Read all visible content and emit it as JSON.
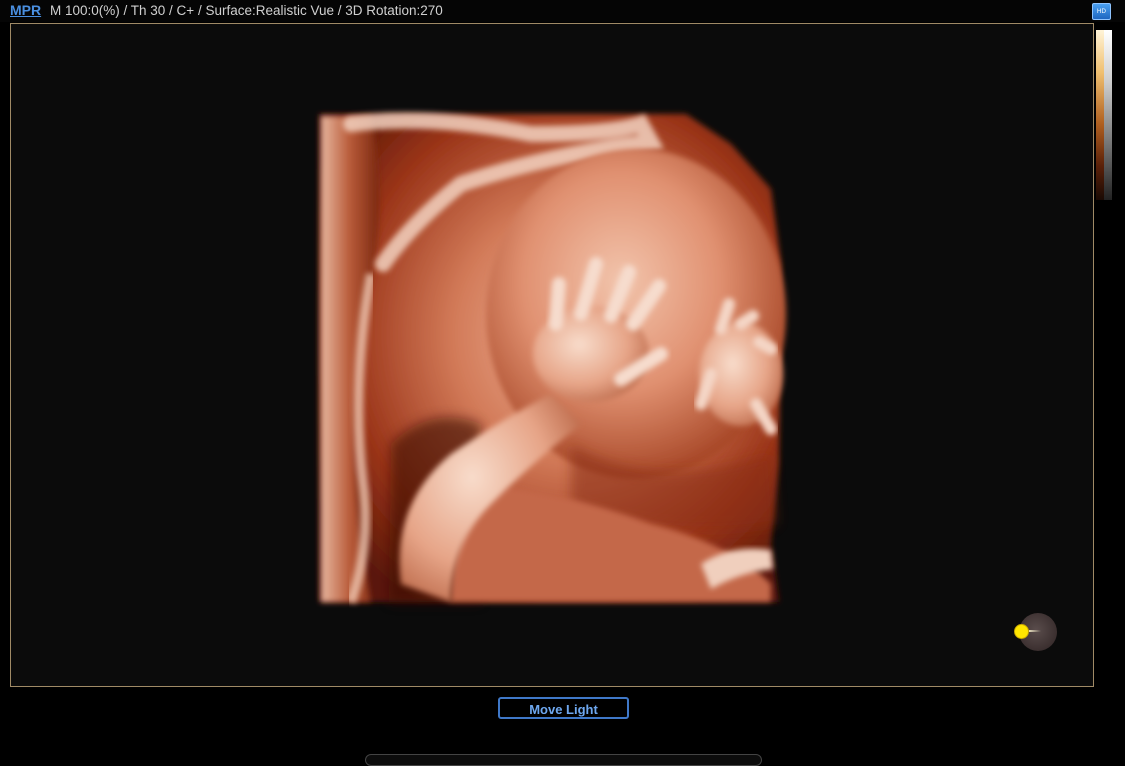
{
  "header": {
    "mode_link": "MPR",
    "status": "M 100:0(%) / Th 30 / C+ / Surface:Realistic Vue / 3D Rotation:270",
    "hd_icon": "HDlive-icon"
  },
  "viewport": {
    "content": "3D surface render of fetus (Realistic Vue)",
    "accent_color": "#a08a66"
  },
  "light_control": {
    "icon": "light-source-icon",
    "dot_color": "#ffe600"
  },
  "buttons": {
    "move_light": "Move Light"
  }
}
